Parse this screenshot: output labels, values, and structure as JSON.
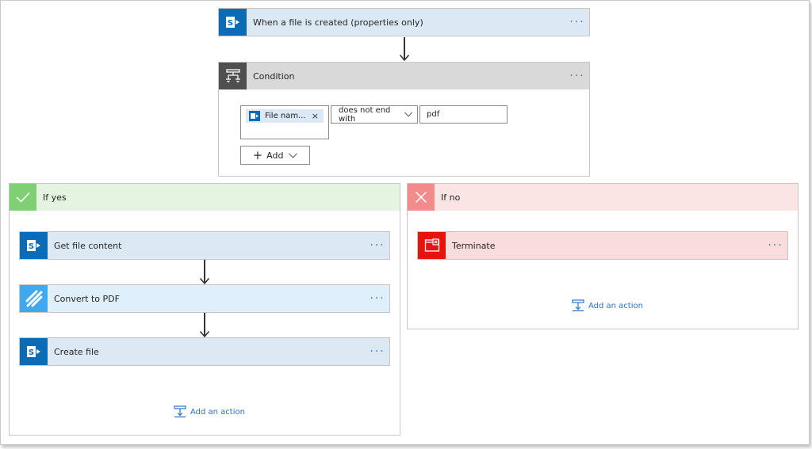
{
  "trigger": {
    "title": "When a file is created (properties only)",
    "menu": "···",
    "icon": "sharepoint-icon"
  },
  "condition": {
    "title": "Condition",
    "menu": "···",
    "icon": "condition-icon",
    "token_label": "File nam...",
    "token_remove": "×",
    "operator": "does not end with",
    "value": "pdf",
    "add_label": "Add"
  },
  "if_yes": {
    "label": "If yes",
    "actions": [
      {
        "title": "Get file content",
        "menu": "···",
        "icon": "sharepoint-icon"
      },
      {
        "title": "Convert to PDF",
        "menu": "···",
        "icon": "convert-icon"
      },
      {
        "title": "Create file",
        "menu": "···",
        "icon": "sharepoint-icon"
      }
    ],
    "add_action": "Add an action"
  },
  "if_no": {
    "label": "If no",
    "actions": [
      {
        "title": "Terminate",
        "menu": "···",
        "icon": "terminate-icon"
      }
    ],
    "add_action": "Add an action"
  },
  "colors": {
    "sharepoint": "#0b6bb5",
    "condition": "#4f4f4f",
    "yes": "#7fcf74",
    "no": "#f28b8b",
    "terminate": "#e8140c",
    "convert": "#3fa9f0",
    "link": "#2f72c4"
  }
}
